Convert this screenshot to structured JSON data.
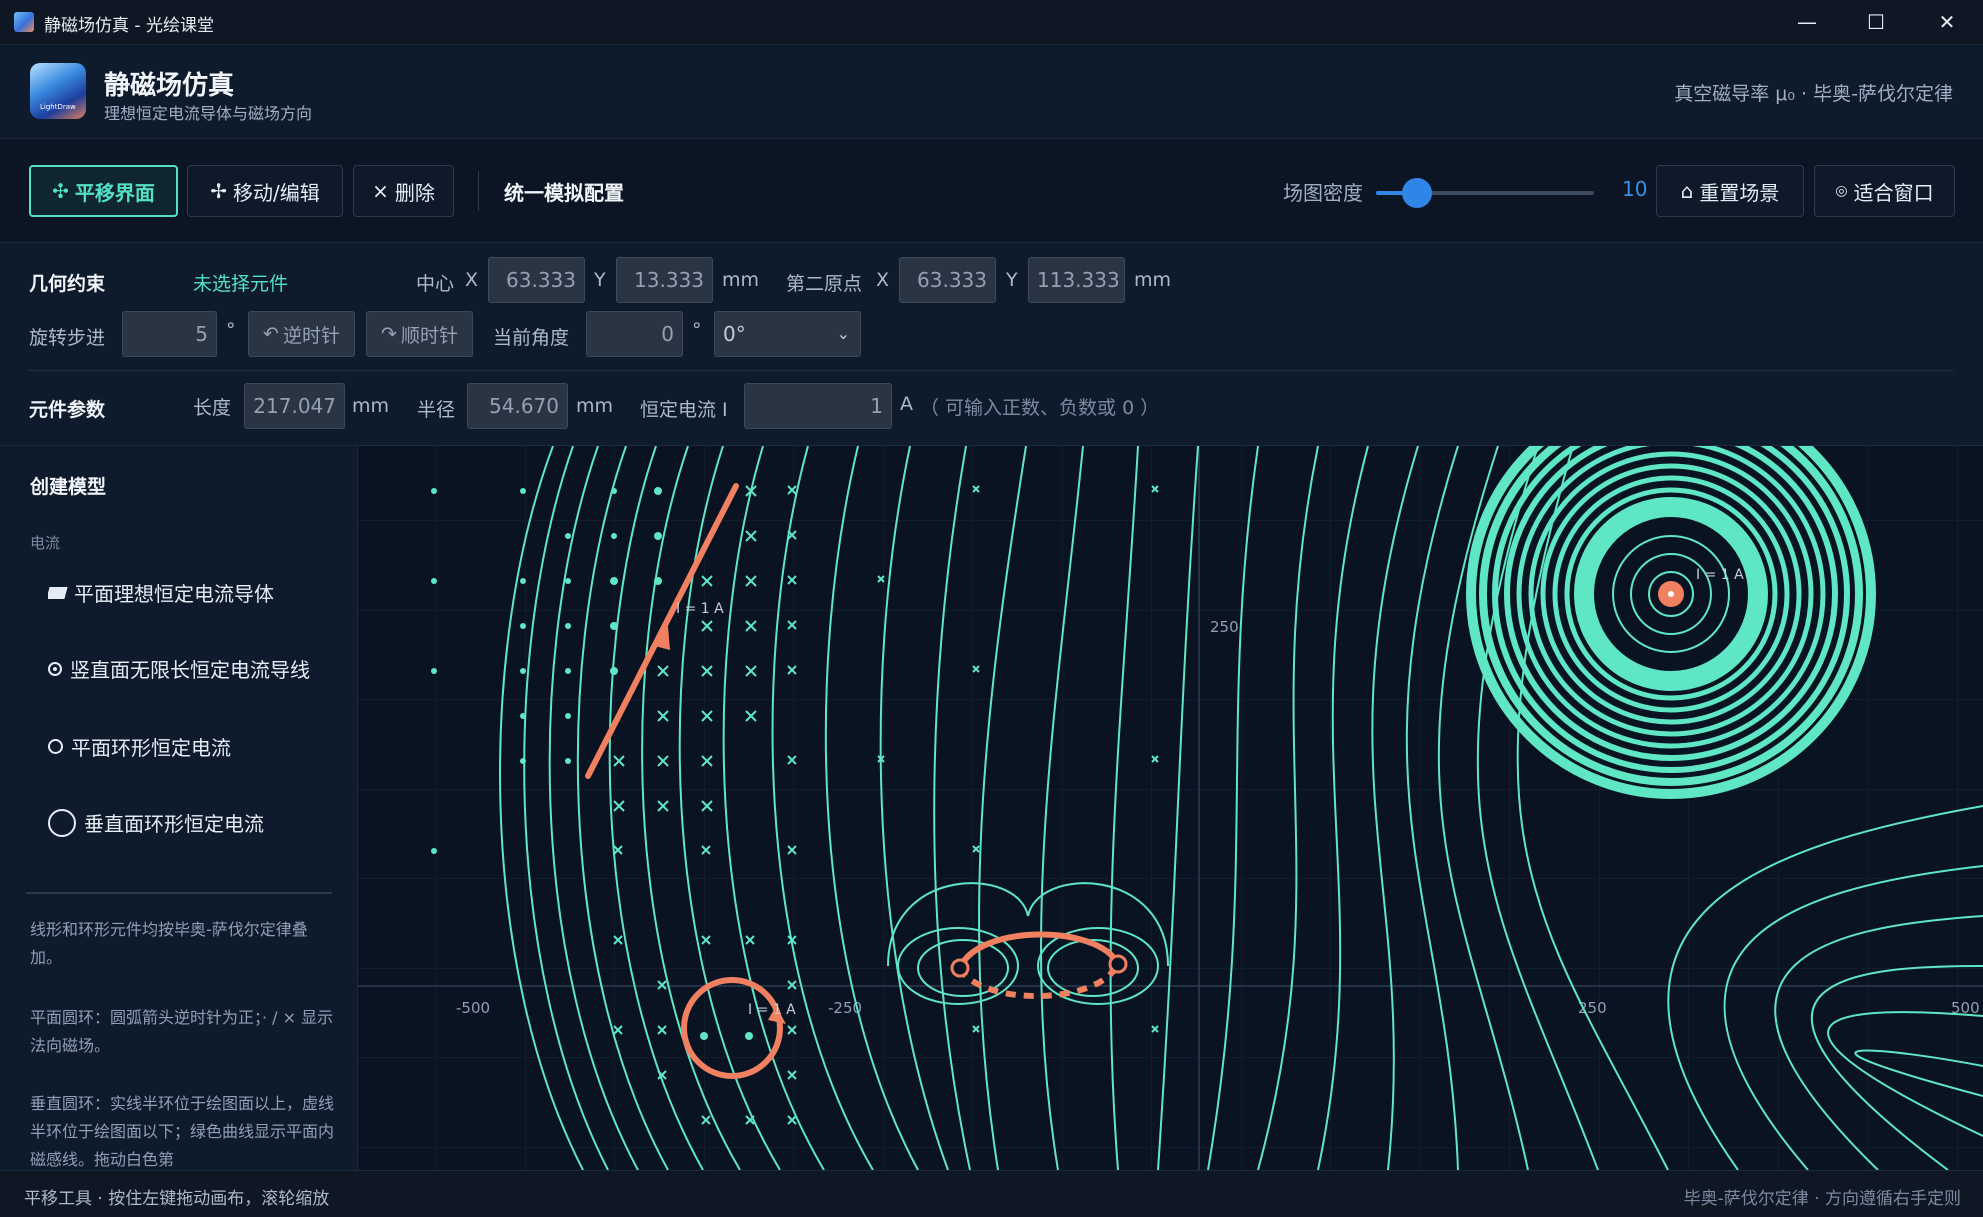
{
  "window": {
    "title": "静磁场仿真 - 光绘课堂",
    "minimize": "—",
    "maximize": "☐",
    "close": "✕"
  },
  "header": {
    "app_name": "静磁场仿真",
    "subtitle": "理想恒定电流导体与磁场方向",
    "logo_text": "LightDraw",
    "right_info": "真空磁导率 μ₀ · 毕奥-萨伐尔定律"
  },
  "toolbar": {
    "pan_label": "平移界面",
    "pan_icon": "✣",
    "move_label": "移动/编辑",
    "move_icon": "✢",
    "delete_label": "删除",
    "delete_icon": "×",
    "config_label": "统一模拟配置",
    "density_label": "场图密度",
    "density_value": "10",
    "density_fraction": 0.2,
    "reset_label": "重置场景",
    "reset_icon": "⌂",
    "fit_label": "适合窗口",
    "fit_icon": "◎"
  },
  "params": {
    "geometry_label": "几何约束",
    "selection_status": "未选择元件",
    "center_label": "中心",
    "x_label": "X",
    "y_label": "Y",
    "center_x": "63.333",
    "center_y": "13.333",
    "unit_mm": "mm",
    "second_origin_label": "第二原点",
    "second_x": "63.333",
    "second_y": "113.333",
    "rotate_step_label": "旋转步进",
    "rotate_step": "5",
    "degree": "°",
    "ccw_label": "逆时针",
    "cw_label": "顺时针",
    "current_angle_label": "当前角度",
    "current_angle": "0",
    "angle_select": "0°",
    "element_params_label": "元件参数",
    "length_label": "长度",
    "length_value": "217.047",
    "radius_label": "半径",
    "radius_value": "54.670",
    "current_label": "恒定电流 I",
    "current_value": "1",
    "ampere": "A",
    "current_hint": "（ 可输入正数、负数或 0 ）"
  },
  "sidebar": {
    "create_title": "创建模型",
    "category": "电流",
    "items": [
      {
        "label": "平面理想恒定电流导体",
        "icon": "planar-conductor-icon"
      },
      {
        "label": "竖直面无限长恒定电流导线",
        "icon": "vertical-wire-icon"
      },
      {
        "label": "平面环形恒定电流",
        "icon": "planar-ring-icon"
      },
      {
        "label": "垂直面环形恒定电流",
        "icon": "vertical-ring-icon"
      }
    ],
    "notes": [
      "线形和环形元件均按毕奥-萨伐尔定律叠加。",
      "平面圆环：圆弧箭头逆时针为正；· / × 显示法向磁场。",
      "垂直圆环：实线半环位于绘图面以上，虚线半环位于绘图面以下；绿色曲线显示平面内磁感线。拖动白色第"
    ]
  },
  "canvas": {
    "axis_ticks": [
      "-500",
      "-250",
      "250",
      "500"
    ],
    "y_tick": "250",
    "current_labels": [
      "I = 1 A",
      "I = 1 A",
      "I = 1 A"
    ],
    "colors": {
      "field": "#5fe6c4",
      "element": "#f0805f",
      "background": "#0a1322"
    }
  },
  "status": {
    "left": "平移工具 · 按住左键拖动画布，滚轮缩放",
    "right": "毕奥-萨伐尔定律 · 方向遵循右手定则"
  }
}
